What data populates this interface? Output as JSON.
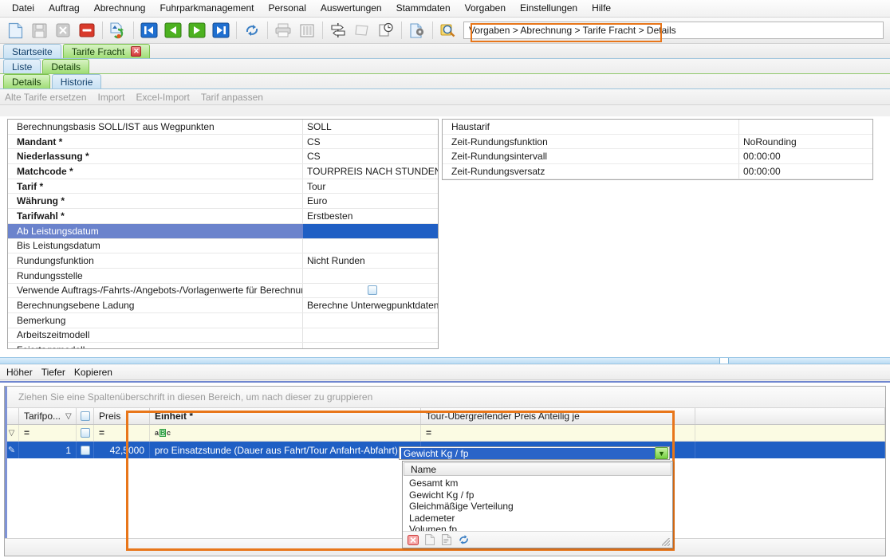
{
  "menubar": {
    "items": [
      {
        "label": "Datei"
      },
      {
        "label": "Auftrag"
      },
      {
        "label": "Abrechnung"
      },
      {
        "label": "Fuhrparkmanagement"
      },
      {
        "label": "Personal"
      },
      {
        "label": "Auswertungen"
      },
      {
        "label": "Stammdaten"
      },
      {
        "label": "Vorgaben"
      },
      {
        "label": "Einstellungen"
      },
      {
        "label": "Hilfe"
      }
    ]
  },
  "toolbar": {
    "icons": [
      {
        "name": "new-document-icon",
        "enabled": true
      },
      {
        "name": "save-icon",
        "enabled": false
      },
      {
        "name": "delete-x-icon",
        "enabled": false
      },
      {
        "name": "remove-red-icon",
        "enabled": true
      },
      {
        "name": "refresh-record-icon",
        "enabled": true
      },
      {
        "name": "first-record-icon",
        "enabled": true
      },
      {
        "name": "previous-record-icon",
        "enabled": true
      },
      {
        "name": "next-record-icon",
        "enabled": true
      },
      {
        "name": "last-record-icon",
        "enabled": true
      },
      {
        "name": "reload-icon",
        "enabled": true
      },
      {
        "name": "print-icon",
        "enabled": false
      },
      {
        "name": "columns-icon",
        "enabled": false
      },
      {
        "name": "signpost-icon",
        "enabled": true
      },
      {
        "name": "note-icon",
        "enabled": false
      },
      {
        "name": "history-clock-icon",
        "enabled": true
      },
      {
        "name": "document-settings-icon",
        "enabled": true
      },
      {
        "name": "search-magnifier-icon",
        "enabled": true
      }
    ],
    "breadcrumb": "Vorgaben > Abrechnung > Tarife Fracht > Details",
    "highlight_color": "#e8761a"
  },
  "tabs_level1": [
    {
      "label": "Startseite",
      "active": false,
      "closable": false
    },
    {
      "label": "Tarife Fracht",
      "active": true,
      "closable": true
    }
  ],
  "tabs_level2": [
    {
      "label": "Liste",
      "active": false
    },
    {
      "label": "Details",
      "active": true
    }
  ],
  "tabs_level3": [
    {
      "label": "Details",
      "active": true
    },
    {
      "label": "Historie",
      "active": false
    }
  ],
  "actionlinks": [
    {
      "label": "Alte Tarife ersetzen",
      "enabled": false
    },
    {
      "label": "Import",
      "enabled": false
    },
    {
      "label": "Excel-Import",
      "enabled": false
    },
    {
      "label": "Tarif anpassen",
      "enabled": false
    }
  ],
  "form_left": {
    "rows": [
      {
        "label": "Berechnungsbasis SOLL/IST aus Wegpunkten",
        "value": "SOLL",
        "required": false,
        "selected": false
      },
      {
        "label": "Mandant *",
        "value": "CS",
        "required": true,
        "selected": false
      },
      {
        "label": "Niederlassung *",
        "value": "CS",
        "required": true,
        "selected": false
      },
      {
        "label": "Matchcode *",
        "value": "TOURPREIS NACH STUNDEN",
        "required": true,
        "selected": false
      },
      {
        "label": "Tarif *",
        "value": "Tour",
        "required": true,
        "selected": false
      },
      {
        "label": "Währung *",
        "value": "Euro",
        "required": true,
        "selected": false
      },
      {
        "label": "Tarifwahl *",
        "value": "Erstbesten",
        "required": true,
        "selected": false
      },
      {
        "label": "Ab Leistungsdatum",
        "value": "",
        "required": false,
        "selected": true
      },
      {
        "label": "Bis Leistungsdatum",
        "value": "",
        "required": false,
        "selected": false
      },
      {
        "label": "Rundungsfunktion",
        "value": "Nicht Runden",
        "required": false,
        "selected": false
      },
      {
        "label": "Rundungsstelle",
        "value": "",
        "required": false,
        "selected": false
      },
      {
        "label": "Verwende Auftrags-/Fahrts-/Angebots-/Vorlagenwerte für Berechnung",
        "value": "",
        "required": false,
        "selected": false,
        "control": "checkbox",
        "checked": false
      },
      {
        "label": "Berechnungsebene Ladung",
        "value": "Berechne Unterwegpunktdaten o...",
        "required": false,
        "selected": false
      },
      {
        "label": "Bemerkung",
        "value": "",
        "required": false,
        "selected": false
      },
      {
        "label": "Arbeitszeitmodell",
        "value": "",
        "required": false,
        "selected": false
      },
      {
        "label": "Feiertagsmodell",
        "value": "",
        "required": false,
        "selected": false
      }
    ]
  },
  "form_right": {
    "rows": [
      {
        "label": "Haustarif",
        "value": ""
      },
      {
        "label": "Zeit-Rundungsfunktion",
        "value": "NoRounding"
      },
      {
        "label": "Zeit-Rundungsintervall",
        "value": "00:00:00"
      },
      {
        "label": "Zeit-Rundungsversatz",
        "value": "00:00:00"
      }
    ]
  },
  "lowerlinks": [
    {
      "label": "Höher"
    },
    {
      "label": "Tiefer"
    },
    {
      "label": "Kopieren"
    }
  ],
  "grid": {
    "group_hint": "Ziehen Sie eine Spaltenüberschrift in diesen Bereich, um nach dieser zu gruppieren",
    "columns": [
      {
        "label": "Tarifpo...",
        "key": "pos",
        "sorted": true,
        "sort_glyph": "▽"
      },
      {
        "label": "",
        "key": "chk"
      },
      {
        "label": "Preis",
        "key": "preis"
      },
      {
        "label": "Einheit *",
        "key": "einheit",
        "bold": true
      },
      {
        "label": "Tour-Übergreifender Preis Anteilig je",
        "key": "tour"
      }
    ],
    "filter_row": {
      "pos": "=",
      "preis": "=",
      "einheit": "aBc",
      "tour": "="
    },
    "rows": [
      {
        "pos": "1",
        "checked": false,
        "preis": "42,5000",
        "einheit": "pro Einsatzstunde (Dauer aus Fahrt/Tour Anfahrt-Abfahrt)",
        "tour": "Gewicht Kg / fp",
        "selected": true
      }
    ]
  },
  "combo_editor": {
    "value": "Gewicht Kg / fp",
    "arrow_glyph": "▼"
  },
  "dropdown": {
    "header": "Name",
    "options": [
      "Gesamt km",
      "Gewicht Kg / fp",
      "Gleichmäßige Verteilung",
      "Lademeter",
      "Volumen fp"
    ],
    "footer_icons": [
      {
        "name": "clear-filter-icon"
      },
      {
        "name": "new-record-icon"
      },
      {
        "name": "edit-record-icon"
      },
      {
        "name": "refresh-list-icon"
      }
    ]
  },
  "colors": {
    "highlight_orange": "#e8761a",
    "selection_blue": "#1f5fc4",
    "row_header_blue": "#6b83cc",
    "filter_yellow": "#fbfbe3",
    "tab_green": "#9fdd76"
  }
}
